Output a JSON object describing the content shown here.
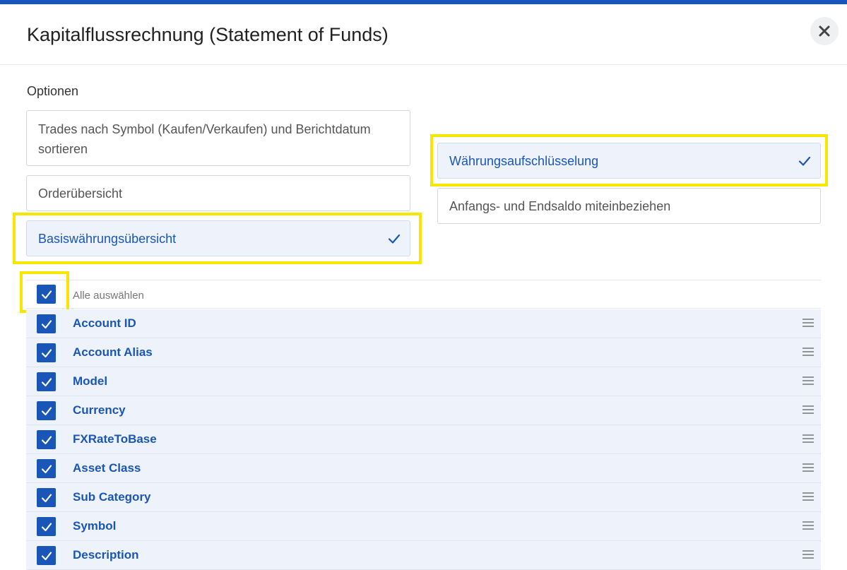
{
  "dialog": {
    "title": "Kapitalflussrechnung (Statement of Funds)"
  },
  "options": {
    "label": "Optionen",
    "items": [
      {
        "label": "Trades nach Symbol (Kaufen/Verkaufen) und Berichtdatum sortieren",
        "selected": false
      },
      {
        "label": "Orderübersicht",
        "selected": false
      },
      {
        "label": "Basiswährungsübersicht",
        "selected": true
      },
      {
        "label": "Währungsaufschlüsselung",
        "selected": true
      },
      {
        "label": "Anfangs- und Endsaldo miteinbeziehen",
        "selected": false
      }
    ]
  },
  "columns": {
    "select_all_label": "Alle auswählen",
    "select_all_checked": true,
    "items": [
      {
        "label": "Account ID",
        "checked": true
      },
      {
        "label": "Account Alias",
        "checked": true
      },
      {
        "label": "Model",
        "checked": true
      },
      {
        "label": "Currency",
        "checked": true
      },
      {
        "label": "FXRateToBase",
        "checked": true
      },
      {
        "label": "Asset Class",
        "checked": true
      },
      {
        "label": "Sub Category",
        "checked": true
      },
      {
        "label": "Symbol",
        "checked": true
      },
      {
        "label": "Description",
        "checked": true
      }
    ]
  },
  "icons": {
    "close": "close-icon",
    "check": "checkmark-icon",
    "drag": "drag-handle-icon"
  },
  "colors": {
    "accent": "#1a56b8",
    "highlight": "#f7e600",
    "selected_bg": "#eef2fa"
  }
}
